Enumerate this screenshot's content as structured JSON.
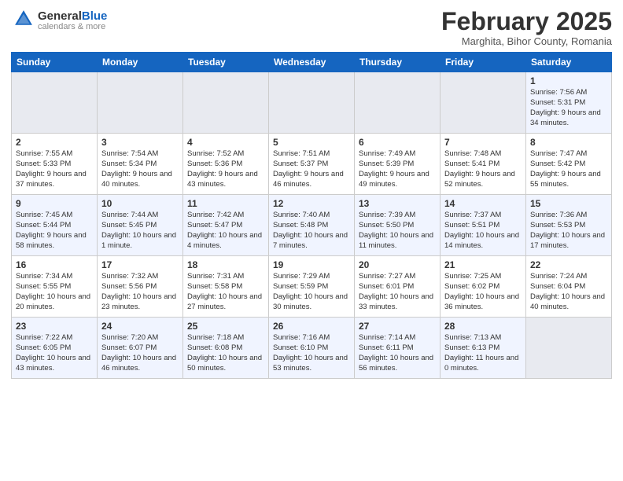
{
  "logo": {
    "general": "General",
    "blue": "Blue"
  },
  "title": "February 2025",
  "location": "Marghita, Bihor County, Romania",
  "days_of_week": [
    "Sunday",
    "Monday",
    "Tuesday",
    "Wednesday",
    "Thursday",
    "Friday",
    "Saturday"
  ],
  "weeks": [
    [
      {
        "day": "",
        "info": ""
      },
      {
        "day": "",
        "info": ""
      },
      {
        "day": "",
        "info": ""
      },
      {
        "day": "",
        "info": ""
      },
      {
        "day": "",
        "info": ""
      },
      {
        "day": "",
        "info": ""
      },
      {
        "day": "1",
        "info": "Sunrise: 7:56 AM\nSunset: 5:31 PM\nDaylight: 9 hours and 34 minutes."
      }
    ],
    [
      {
        "day": "2",
        "info": "Sunrise: 7:55 AM\nSunset: 5:33 PM\nDaylight: 9 hours and 37 minutes."
      },
      {
        "day": "3",
        "info": "Sunrise: 7:54 AM\nSunset: 5:34 PM\nDaylight: 9 hours and 40 minutes."
      },
      {
        "day": "4",
        "info": "Sunrise: 7:52 AM\nSunset: 5:36 PM\nDaylight: 9 hours and 43 minutes."
      },
      {
        "day": "5",
        "info": "Sunrise: 7:51 AM\nSunset: 5:37 PM\nDaylight: 9 hours and 46 minutes."
      },
      {
        "day": "6",
        "info": "Sunrise: 7:49 AM\nSunset: 5:39 PM\nDaylight: 9 hours and 49 minutes."
      },
      {
        "day": "7",
        "info": "Sunrise: 7:48 AM\nSunset: 5:41 PM\nDaylight: 9 hours and 52 minutes."
      },
      {
        "day": "8",
        "info": "Sunrise: 7:47 AM\nSunset: 5:42 PM\nDaylight: 9 hours and 55 minutes."
      }
    ],
    [
      {
        "day": "9",
        "info": "Sunrise: 7:45 AM\nSunset: 5:44 PM\nDaylight: 9 hours and 58 minutes."
      },
      {
        "day": "10",
        "info": "Sunrise: 7:44 AM\nSunset: 5:45 PM\nDaylight: 10 hours and 1 minute."
      },
      {
        "day": "11",
        "info": "Sunrise: 7:42 AM\nSunset: 5:47 PM\nDaylight: 10 hours and 4 minutes."
      },
      {
        "day": "12",
        "info": "Sunrise: 7:40 AM\nSunset: 5:48 PM\nDaylight: 10 hours and 7 minutes."
      },
      {
        "day": "13",
        "info": "Sunrise: 7:39 AM\nSunset: 5:50 PM\nDaylight: 10 hours and 11 minutes."
      },
      {
        "day": "14",
        "info": "Sunrise: 7:37 AM\nSunset: 5:51 PM\nDaylight: 10 hours and 14 minutes."
      },
      {
        "day": "15",
        "info": "Sunrise: 7:36 AM\nSunset: 5:53 PM\nDaylight: 10 hours and 17 minutes."
      }
    ],
    [
      {
        "day": "16",
        "info": "Sunrise: 7:34 AM\nSunset: 5:55 PM\nDaylight: 10 hours and 20 minutes."
      },
      {
        "day": "17",
        "info": "Sunrise: 7:32 AM\nSunset: 5:56 PM\nDaylight: 10 hours and 23 minutes."
      },
      {
        "day": "18",
        "info": "Sunrise: 7:31 AM\nSunset: 5:58 PM\nDaylight: 10 hours and 27 minutes."
      },
      {
        "day": "19",
        "info": "Sunrise: 7:29 AM\nSunset: 5:59 PM\nDaylight: 10 hours and 30 minutes."
      },
      {
        "day": "20",
        "info": "Sunrise: 7:27 AM\nSunset: 6:01 PM\nDaylight: 10 hours and 33 minutes."
      },
      {
        "day": "21",
        "info": "Sunrise: 7:25 AM\nSunset: 6:02 PM\nDaylight: 10 hours and 36 minutes."
      },
      {
        "day": "22",
        "info": "Sunrise: 7:24 AM\nSunset: 6:04 PM\nDaylight: 10 hours and 40 minutes."
      }
    ],
    [
      {
        "day": "23",
        "info": "Sunrise: 7:22 AM\nSunset: 6:05 PM\nDaylight: 10 hours and 43 minutes."
      },
      {
        "day": "24",
        "info": "Sunrise: 7:20 AM\nSunset: 6:07 PM\nDaylight: 10 hours and 46 minutes."
      },
      {
        "day": "25",
        "info": "Sunrise: 7:18 AM\nSunset: 6:08 PM\nDaylight: 10 hours and 50 minutes."
      },
      {
        "day": "26",
        "info": "Sunrise: 7:16 AM\nSunset: 6:10 PM\nDaylight: 10 hours and 53 minutes."
      },
      {
        "day": "27",
        "info": "Sunrise: 7:14 AM\nSunset: 6:11 PM\nDaylight: 10 hours and 56 minutes."
      },
      {
        "day": "28",
        "info": "Sunrise: 7:13 AM\nSunset: 6:13 PM\nDaylight: 11 hours and 0 minutes."
      },
      {
        "day": "",
        "info": ""
      }
    ]
  ]
}
